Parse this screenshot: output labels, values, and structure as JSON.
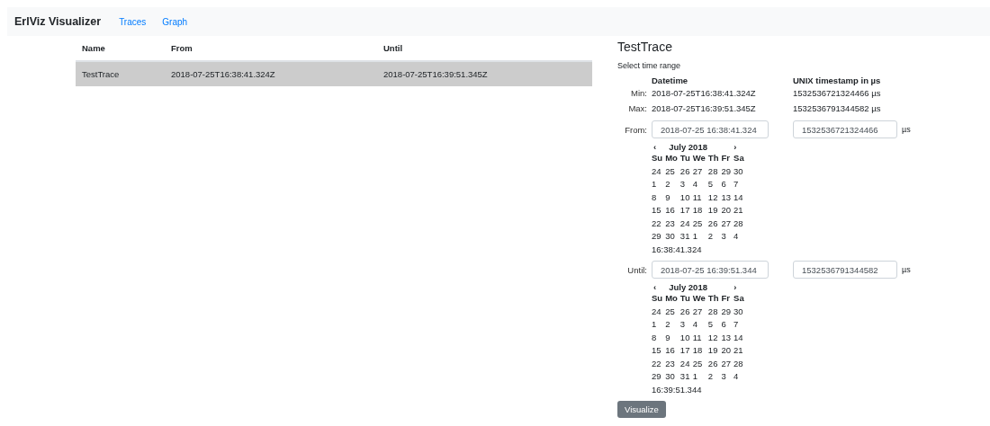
{
  "navbar": {
    "brand": "ErlViz Visualizer",
    "links": [
      {
        "label": "Traces"
      },
      {
        "label": "Graph"
      }
    ]
  },
  "table": {
    "columns": [
      "Name",
      "From",
      "Until"
    ],
    "rows": [
      {
        "cells": [
          "TestTrace",
          "2018-07-25T16:38:41.324Z",
          "2018-07-25T16:39:51.345Z"
        ],
        "selected": true
      }
    ]
  },
  "detail": {
    "title": "TestTrace",
    "subtitle": "Select time range",
    "headers": [
      "Datetime",
      "UNIX timestamp in µs"
    ],
    "ranges": [
      {
        "label": "Min:",
        "datetime": "2018-07-25T16:38:41.324Z",
        "timestamp": "1532536721324466 µs"
      },
      {
        "label": "Max:",
        "datetime": "2018-07-25T16:39:51.345Z",
        "timestamp": "1532536791344582 µs"
      }
    ],
    "pickers": [
      {
        "label": "From:",
        "value": "2018-07-25 16:38:41.324",
        "timestamp": "1532536721324466",
        "unit": "µs",
        "calendar": {
          "prev": "‹",
          "month": "July 2018",
          "next": "›",
          "weekdays": [
            "Su",
            "Mo",
            "Tu",
            "We",
            "Th",
            "Fr",
            "Sa"
          ],
          "weeks": [
            [
              "24",
              "25",
              "26",
              "27",
              "28",
              "29",
              "30"
            ],
            [
              "1",
              "2",
              "3",
              "4",
              "5",
              "6",
              "7"
            ],
            [
              "8",
              "9",
              "10",
              "11",
              "12",
              "13",
              "14"
            ],
            [
              "15",
              "16",
              "17",
              "18",
              "19",
              "20",
              "21"
            ],
            [
              "22",
              "23",
              "24",
              "25",
              "26",
              "27",
              "28"
            ],
            [
              "29",
              "30",
              "31",
              "1",
              "2",
              "3",
              "4"
            ]
          ],
          "time": "16:38:41.324"
        }
      },
      {
        "label": "Until:",
        "value": "2018-07-25 16:39:51.344",
        "timestamp": "1532536791344582",
        "unit": "µs",
        "calendar": {
          "prev": "‹",
          "month": "July 2018",
          "next": "›",
          "weekdays": [
            "Su",
            "Mo",
            "Tu",
            "We",
            "Th",
            "Fr",
            "Sa"
          ],
          "weeks": [
            [
              "24",
              "25",
              "26",
              "27",
              "28",
              "29",
              "30"
            ],
            [
              "1",
              "2",
              "3",
              "4",
              "5",
              "6",
              "7"
            ],
            [
              "8",
              "9",
              "10",
              "11",
              "12",
              "13",
              "14"
            ],
            [
              "15",
              "16",
              "17",
              "18",
              "19",
              "20",
              "21"
            ],
            [
              "22",
              "23",
              "24",
              "25",
              "26",
              "27",
              "28"
            ],
            [
              "29",
              "30",
              "31",
              "1",
              "2",
              "3",
              "4"
            ]
          ],
          "time": "16:39:51.344"
        }
      }
    ],
    "button": "Visualize"
  }
}
